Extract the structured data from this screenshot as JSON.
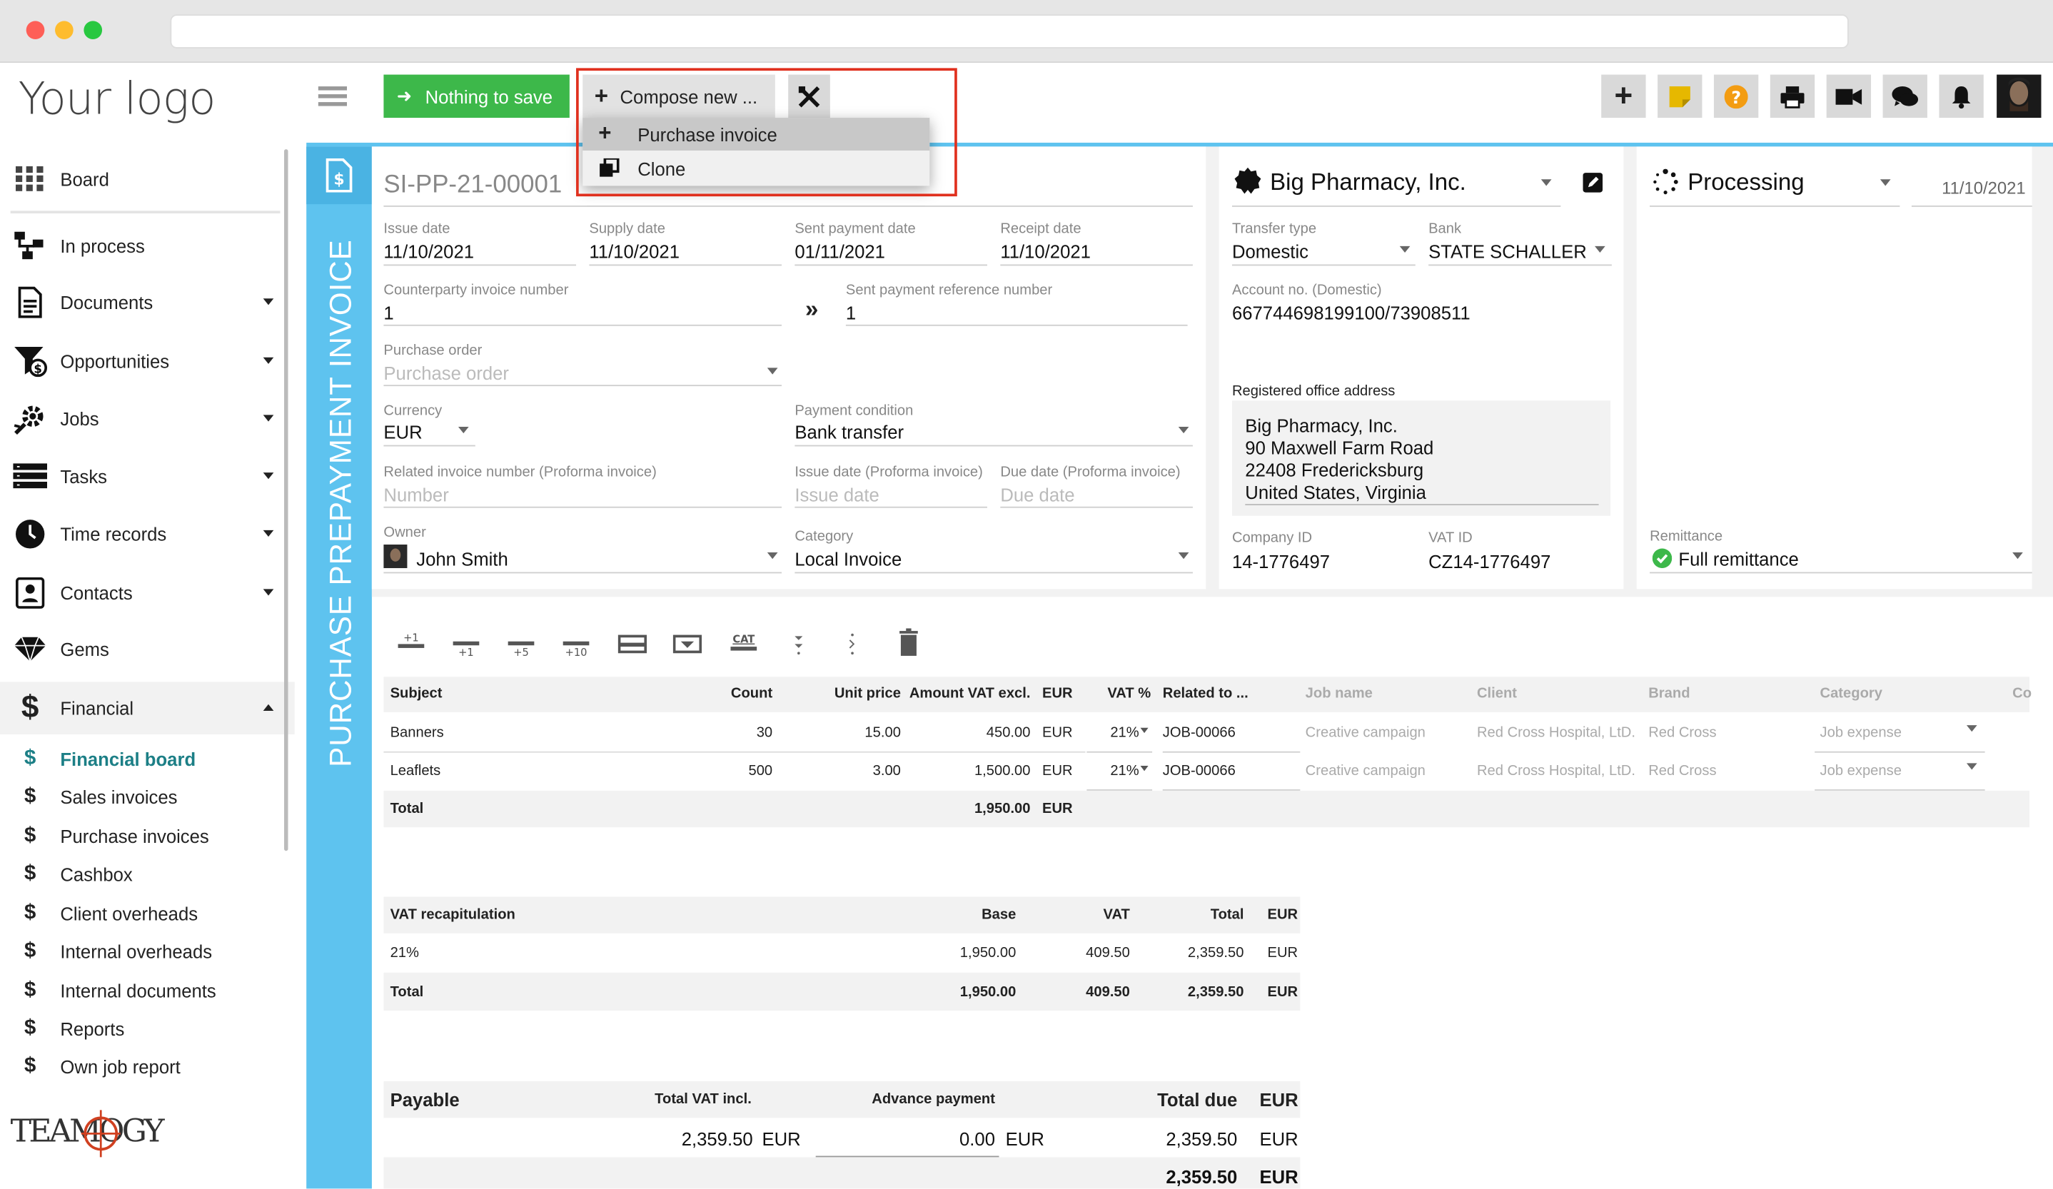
{
  "app": {
    "logo_text": "Your logo",
    "footer_brand": "TEAMOGY"
  },
  "colors": {
    "accent_blue": "#5ec3ef",
    "green_button": "#3db84a",
    "highlight_red": "#e0301e",
    "teal_active": "#1c7f86"
  },
  "sidebar": {
    "items": [
      {
        "label": "Board",
        "icon": "grid-icon"
      },
      {
        "label": "In process",
        "icon": "workflow-icon"
      },
      {
        "label": "Documents",
        "icon": "document-icon"
      },
      {
        "label": "Opportunities",
        "icon": "funnel-icon"
      },
      {
        "label": "Jobs",
        "icon": "gear-icon"
      },
      {
        "label": "Tasks",
        "icon": "tasks-icon"
      },
      {
        "label": "Time records",
        "icon": "clock-icon"
      },
      {
        "label": "Contacts",
        "icon": "contacts-icon"
      },
      {
        "label": "Gems",
        "icon": "gem-icon"
      },
      {
        "label": "Financial",
        "icon": "dollar-icon"
      }
    ],
    "sub_items": [
      {
        "label": "Financial board",
        "active": true
      },
      {
        "label": "Sales invoices"
      },
      {
        "label": "Purchase invoices"
      },
      {
        "label": "Cashbox"
      },
      {
        "label": "Client overheads"
      },
      {
        "label": "Internal overheads"
      },
      {
        "label": "Internal documents"
      },
      {
        "label": "Reports"
      },
      {
        "label": "Own job report"
      }
    ]
  },
  "toolbar": {
    "save_label": "Nothing to save",
    "compose_label": "Compose new ...",
    "menu_items": [
      "Purchase invoice",
      "Clone"
    ],
    "right_icons": [
      "plus-icon",
      "note-icon",
      "help-icon",
      "print-icon",
      "video-icon",
      "chat-icon",
      "bell-icon",
      "user-avatar"
    ]
  },
  "document": {
    "type_title": "PURCHASE PREPAYMENT INVOICE",
    "number": "SI-PP-21-00001",
    "fields": {
      "issue_date": {
        "label": "Issue date",
        "value": "11/10/2021"
      },
      "supply_date": {
        "label": "Supply date",
        "value": "11/10/2021"
      },
      "sent_payment_date": {
        "label": "Sent payment date",
        "value": "01/11/2021"
      },
      "receipt_date": {
        "label": "Receipt date",
        "value": "11/10/2021"
      },
      "counterparty_invoice_number": {
        "label": "Counterparty invoice number",
        "value": "1"
      },
      "sent_payment_reference": {
        "label": "Sent payment reference number",
        "value": "1"
      },
      "purchase_order": {
        "label": "Purchase order",
        "placeholder": "Purchase order"
      },
      "currency": {
        "label": "Currency",
        "value": "EUR"
      },
      "payment_condition": {
        "label": "Payment condition",
        "value": "Bank transfer"
      },
      "related_invoice": {
        "label": "Related invoice number (Proforma invoice)",
        "placeholder": "Number"
      },
      "issue_date_proforma": {
        "label": "Issue date (Proforma invoice)",
        "placeholder": "Issue date"
      },
      "due_date_proforma": {
        "label": "Due date (Proforma invoice)",
        "placeholder": "Due date"
      },
      "owner": {
        "label": "Owner",
        "value": "John Smith"
      },
      "category": {
        "label": "Category",
        "value": "Local Invoice"
      }
    }
  },
  "company": {
    "name": "Big Pharmacy, Inc.",
    "transfer_type": {
      "label": "Transfer type",
      "value": "Domestic"
    },
    "bank": {
      "label": "Bank",
      "value": "STATE SCHALLER"
    },
    "account": {
      "label": "Account no. (Domestic)",
      "value": "667744698199100/73908511"
    },
    "address_label": "Registered office address",
    "address_lines": [
      "Big Pharmacy, Inc.",
      "90 Maxwell Farm Road",
      "22408 Fredericksburg",
      "United States, Virginia"
    ],
    "company_id": {
      "label": "Company ID",
      "value": "14-1776497"
    },
    "vat_id": {
      "label": "VAT ID",
      "value": "CZ14-1776497"
    }
  },
  "status": {
    "value": "Processing",
    "date": "11/10/2021",
    "remittance": {
      "label": "Remittance",
      "value": "Full remittance"
    }
  },
  "items_tools": [
    "+1",
    "+1",
    "+5",
    "+10",
    "",
    "",
    "CAT",
    "",
    "",
    ""
  ],
  "items_table": {
    "headers": [
      "Subject",
      "Count",
      "Unit price",
      "Amount VAT excl.",
      "EUR",
      "VAT %",
      "Related to ...",
      "Job name",
      "Client",
      "Brand",
      "Category",
      "Co"
    ],
    "rows": [
      {
        "subject": "Banners",
        "count": "30",
        "unit_price": "15.00",
        "amount": "450.00",
        "cur": "EUR",
        "vat": "21%",
        "related": "JOB-00066",
        "job_name": "Creative campaign",
        "client": "Red Cross Hospital, LtD.",
        "brand": "Red Cross",
        "category": "Job expense"
      },
      {
        "subject": "Leaflets",
        "count": "500",
        "unit_price": "3.00",
        "amount": "1,500.00",
        "cur": "EUR",
        "vat": "21%",
        "related": "JOB-00066",
        "job_name": "Creative campaign",
        "client": "Red Cross Hospital, LtD.",
        "brand": "Red Cross",
        "category": "Job expense"
      }
    ],
    "total": {
      "label": "Total",
      "amount": "1,950.00",
      "cur": "EUR"
    }
  },
  "vat_table": {
    "headers": [
      "VAT recapitulation",
      "Base",
      "VAT",
      "Total",
      "EUR"
    ],
    "rows": [
      {
        "rate": "21%",
        "base": "1,950.00",
        "vat": "409.50",
        "total": "2,359.50",
        "cur": "EUR"
      }
    ],
    "total": {
      "label": "Total",
      "base": "1,950.00",
      "vat": "409.50",
      "total": "2,359.50",
      "cur": "EUR"
    }
  },
  "payable": {
    "label": "Payable",
    "total_vat_incl_label": "Total VAT incl.",
    "advance_label": "Advance payment",
    "total_due_label": "Total due",
    "cur_label": "EUR",
    "total_vat_incl": "2,359.50",
    "total_vat_cur": "EUR",
    "advance": "0.00",
    "advance_cur": "EUR",
    "total_due": "2,359.50",
    "total_due_cur": "EUR",
    "grand_total": "2,359.50",
    "grand_cur": "EUR"
  }
}
